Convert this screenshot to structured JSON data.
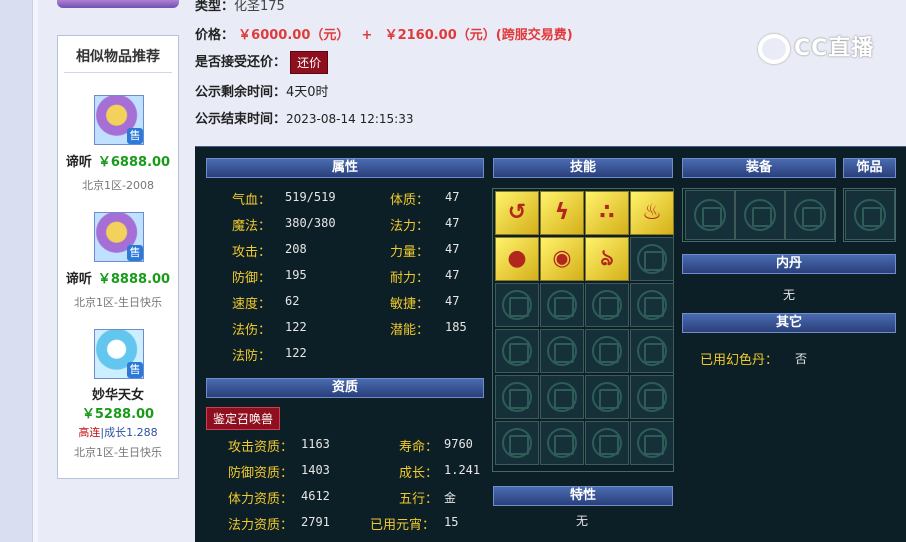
{
  "sidebar": {
    "title": "相似物品推荐",
    "items": [
      {
        "name": "谛听",
        "price": "￥6888.00",
        "server": "北京1区-2008",
        "sell_badge": "售"
      },
      {
        "name": "谛听",
        "price": "￥8888.00",
        "server": "北京1区-生日快乐",
        "sell_badge": "售"
      },
      {
        "name": "妙华天女",
        "price": "￥5288.00",
        "tag_red": "高连",
        "tag_sep": "|",
        "tag_blue": "成长1.288",
        "server": "北京1区-生日快乐",
        "sell_badge": "售"
      }
    ]
  },
  "info": {
    "type_label": "类型：",
    "type_value": "化圣175",
    "price_label": "价格：",
    "price_main": "￥6000.00（元）",
    "price_plus": "+",
    "price_fee": "￥2160.00（元）(跨服交易费)",
    "offer_label": "是否接受还价：",
    "offer_button": "还价",
    "remaining_label": "公示剩余时间：",
    "remaining_value": "4天0时",
    "end_label": "公示结束时间：",
    "end_value": "2023-08-14 12:15:33"
  },
  "watermark": "CC直播",
  "panel": {
    "attributes_header": "属性",
    "attributes": [
      {
        "label": "气血：",
        "value": "519/519"
      },
      {
        "label": "体质：",
        "value": "47"
      },
      {
        "label": "魔法：",
        "value": "380/380"
      },
      {
        "label": "法力：",
        "value": "47"
      },
      {
        "label": "攻击：",
        "value": "208"
      },
      {
        "label": "力量：",
        "value": "47"
      },
      {
        "label": "防御：",
        "value": "195"
      },
      {
        "label": "耐力：",
        "value": "47"
      },
      {
        "label": "速度：",
        "value": "62"
      },
      {
        "label": "敏捷：",
        "value": "47"
      },
      {
        "label": "法伤：",
        "value": "122"
      },
      {
        "label": "潜能：",
        "value": "185"
      },
      {
        "label": "法防：",
        "value": "122"
      }
    ],
    "aptitude_header": "资质",
    "appraise_button": "鉴定召唤兽",
    "aptitudes": [
      {
        "label": "攻击资质：",
        "value": "1163"
      },
      {
        "label": "寿命：",
        "value": "9760"
      },
      {
        "label": "防御资质：",
        "value": "1403"
      },
      {
        "label": "成长：",
        "value": "1.241"
      },
      {
        "label": "体力资质：",
        "value": "4612"
      },
      {
        "label": "五行：",
        "value": "金"
      },
      {
        "label": "法力资质：",
        "value": "2791"
      },
      {
        "label": "已用元宵：",
        "value": "15"
      }
    ],
    "skills_header": "技能",
    "skills": [
      "swirl-skill-icon",
      "lightning-skill-icon",
      "meteor-skill-icon",
      "fire-skill-icon",
      "orbs-skill-icon",
      "eye-skill-icon",
      "flame-swirl-skill-icon"
    ],
    "traits_header": "特性",
    "traits_value": "无",
    "equipment_header": "装备",
    "accessory_header": "饰品",
    "inner_dan_header": "内丹",
    "inner_dan_value": "无",
    "other_header": "其它",
    "other_label": "已用幻色丹：",
    "other_value": "否"
  }
}
